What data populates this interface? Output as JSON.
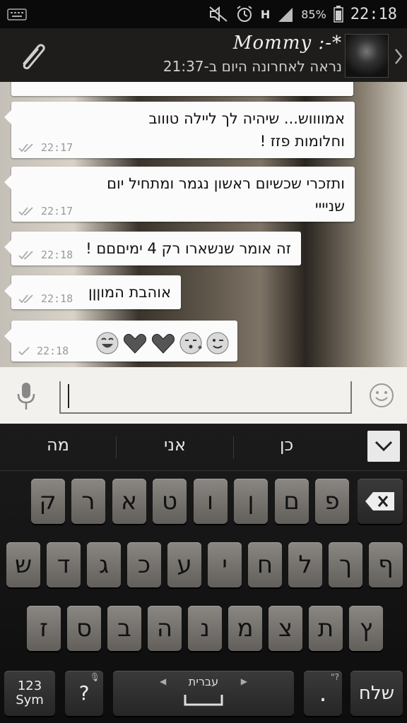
{
  "status_bar": {
    "battery": "85%",
    "time": "22:18",
    "network": "H"
  },
  "header": {
    "contact_name": "Mommy :-*",
    "last_seen": "נראה לאחרונה היום ב-21:37"
  },
  "messages": [
    {
      "text": "אמווווש... שיהיה לך ליילה טוווב\nוחלומות פזז !",
      "time": "22:17",
      "ticks": "double"
    },
    {
      "text": "ותזכרי שכשיום ראשון נגמר ומתחיל יום\nשניייי",
      "time": "22:17",
      "ticks": "double"
    },
    {
      "text": "זה אומר שנשארו רק 4 ימיםםם !",
      "time": "22:18",
      "ticks": "double"
    },
    {
      "text": "אוהבת המוןןן",
      "time": "22:18",
      "ticks": "double"
    },
    {
      "text": "",
      "time": "22:18",
      "ticks": "single",
      "emojis": [
        "wink-emoji",
        "kiss-emoji",
        "heart-emoji",
        "heart-emoji",
        "laugh-emoji"
      ]
    }
  ],
  "suggestions": [
    "כן",
    "אני",
    "מה"
  ],
  "keyboard": {
    "row1": [
      "פ",
      "ם",
      "ן",
      "ו",
      "ט",
      "א",
      "ר",
      "ק"
    ],
    "row2": [
      "ף",
      "ך",
      "ל",
      "ח",
      "י",
      "ע",
      "כ",
      "ג",
      "ד",
      "ש"
    ],
    "row3": [
      "ץ",
      "ת",
      "צ",
      "מ",
      "נ",
      "ה",
      "ב",
      "ס",
      "ז"
    ],
    "sym_key": "123\nSym",
    "question_key": "?",
    "space_label": "עברית",
    "period_key": ".",
    "send_key": "שלח"
  }
}
